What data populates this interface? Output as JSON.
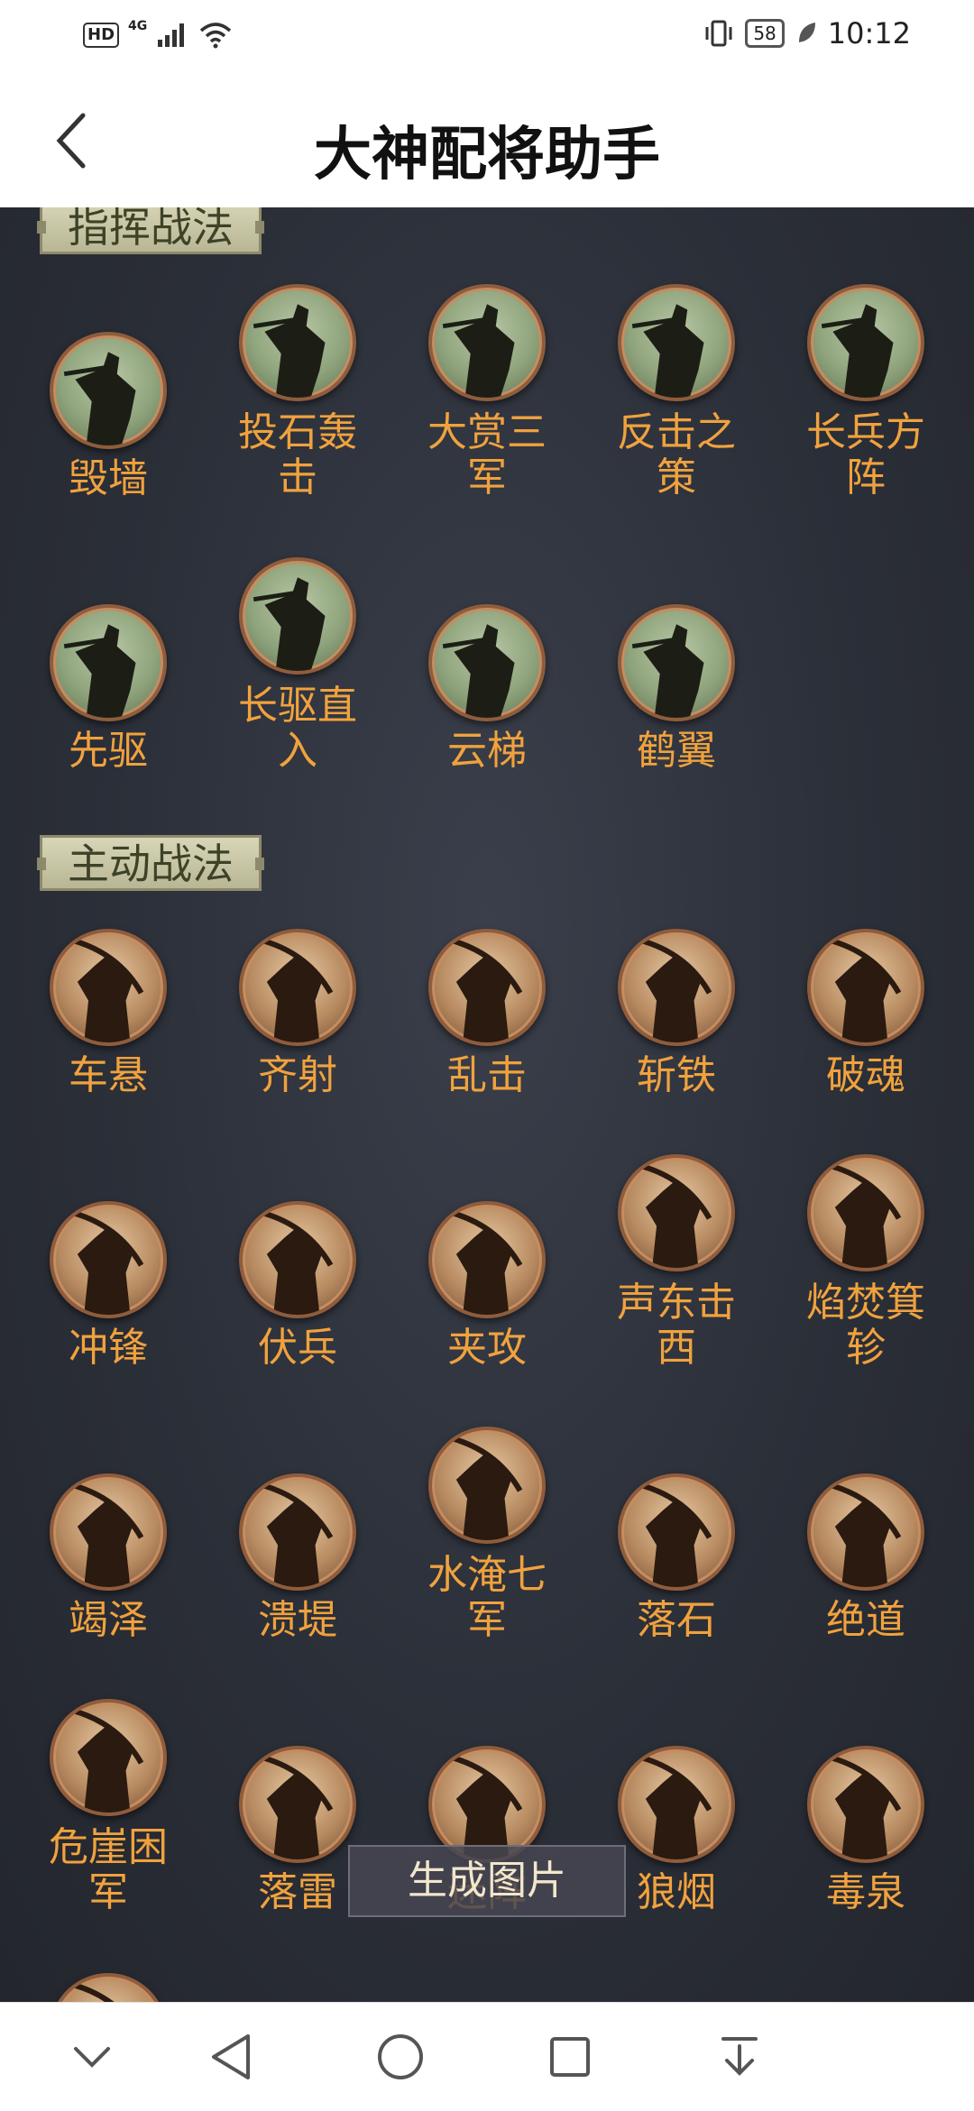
{
  "status_bar": {
    "hd": "HD",
    "network": "4G",
    "battery": "58",
    "time": "10:12"
  },
  "app_bar": {
    "title": "大神配将助手"
  },
  "sections": {
    "command": {
      "label": "指挥战法",
      "items": [
        "毁墙",
        "投石轰击",
        "大赏三军",
        "反击之策",
        "长兵方阵",
        "先驱",
        "长驱直入",
        "云梯",
        "鹤翼"
      ]
    },
    "active": {
      "label": "主动战法",
      "items": [
        "车悬",
        "齐射",
        "乱击",
        "斩铁",
        "破魂",
        "冲锋",
        "伏兵",
        "夹攻",
        "声东击西",
        "焰焚箕轸",
        "竭泽",
        "溃堤",
        "水淹七军",
        "落石",
        "绝道",
        "危崖困军",
        "落雷",
        "迷阵",
        "狼烟",
        "毒泉"
      ]
    }
  },
  "generate_button": {
    "label": "生成图片"
  },
  "colors": {
    "label_text": "#f0a23e",
    "section_bg": "#c9c7a4",
    "background": "#2a2d35"
  },
  "icons": {
    "command_skill": "general-green-icon",
    "active_skill": "warrior-tan-icon"
  }
}
